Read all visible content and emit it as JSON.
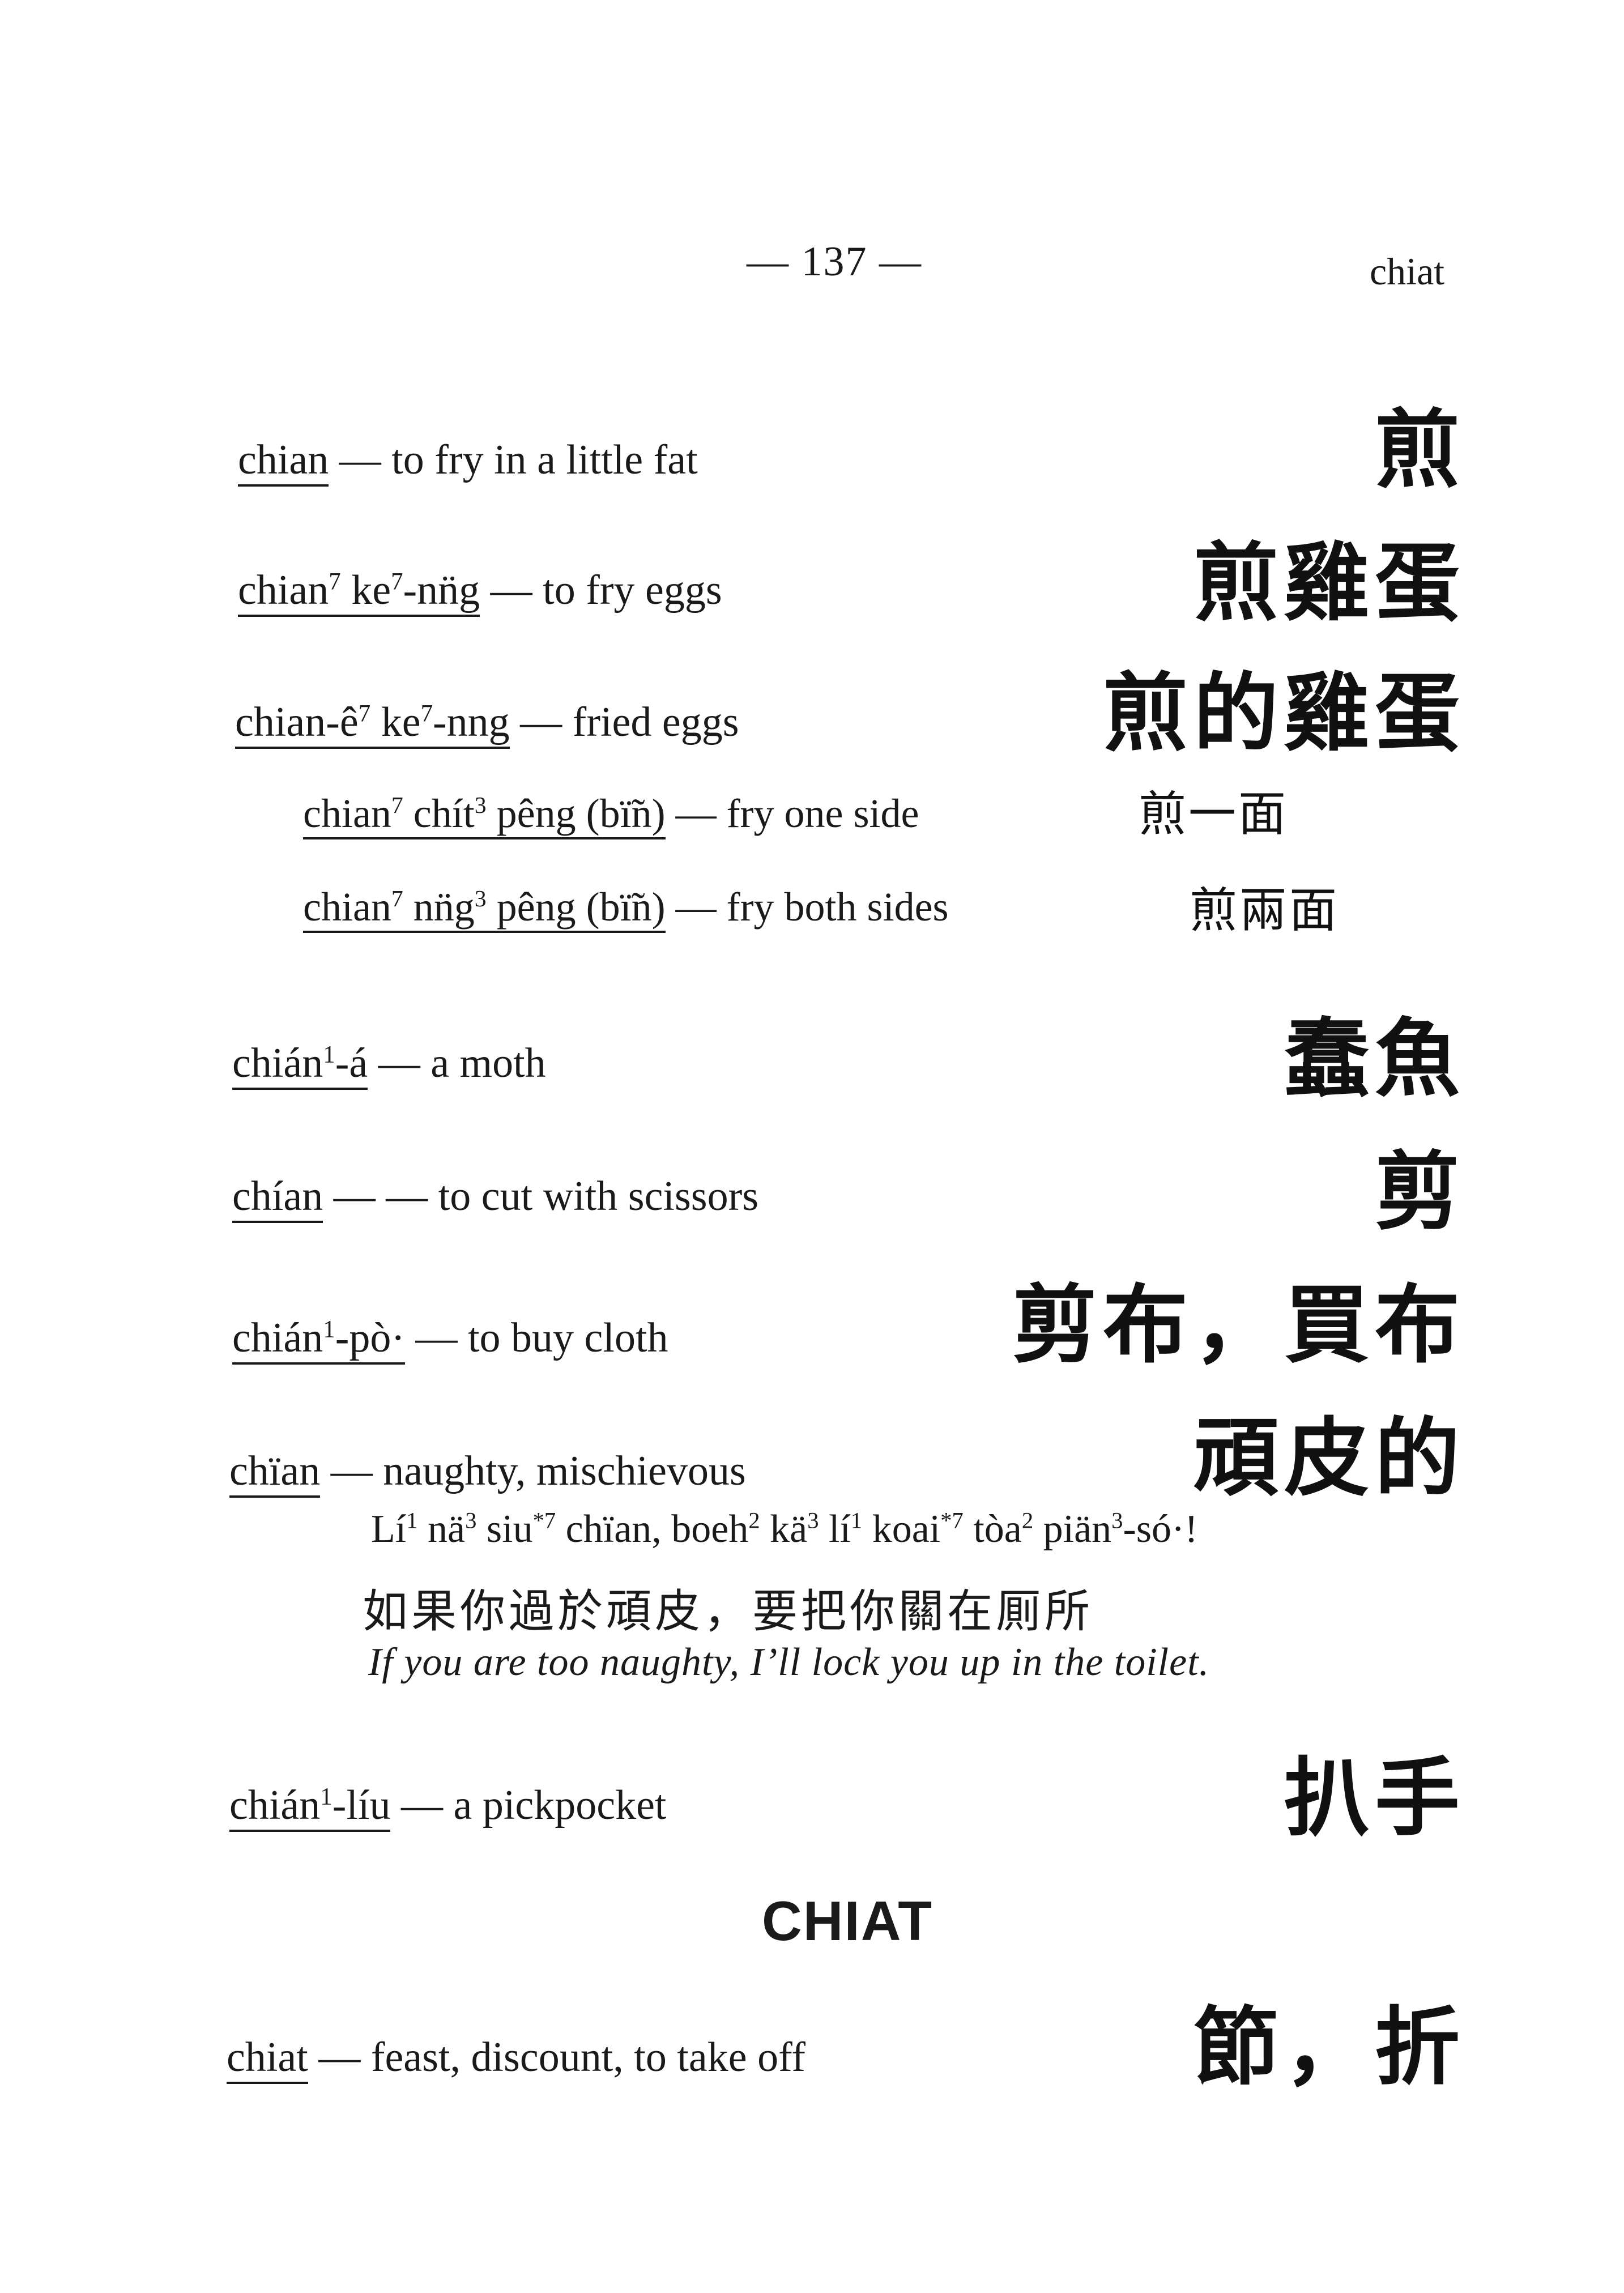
{
  "page": {
    "number_text": "— 137 —",
    "running_head": "chiat"
  },
  "entries": [
    {
      "term": "chian",
      "definition": "to fry in a little fat",
      "hanzi": "煎"
    },
    {
      "term_parts": [
        "chian",
        "7",
        " ke",
        "7",
        "-nn̈g"
      ],
      "definition": "to fry eggs",
      "hanzi": "煎雞蛋"
    },
    {
      "term_parts": [
        "chian-ê",
        "7",
        " ke",
        "7",
        "-nng"
      ],
      "definition": "fried eggs",
      "hanzi": "煎的雞蛋"
    },
    {
      "term_parts": [
        "chian",
        "7",
        " chít",
        "3",
        " pêng (bï̃n)"
      ],
      "definition": "fry one side",
      "hanzi": "煎一面"
    },
    {
      "term_parts": [
        "chian",
        "7",
        " nn̈g",
        "3",
        " pêng (bï̃n)"
      ],
      "definition": "fry both sides",
      "hanzi": "煎兩面"
    },
    {
      "term_parts": [
        "chián",
        "1",
        "-á"
      ],
      "definition": "a moth",
      "hanzi": "蠢魚"
    },
    {
      "term": "chían",
      "definition": "— to cut with scissors",
      "hanzi": "剪"
    },
    {
      "term_parts": [
        "chián",
        "1",
        "-pò·"
      ],
      "definition": "to buy cloth",
      "hanzi": "剪布，買布"
    },
    {
      "term": "chïan",
      "definition": "naughty, mischievous",
      "hanzi": "頑皮的"
    },
    {
      "term_parts": [
        "chián",
        "1",
        "-líu"
      ],
      "definition": "a pickpocket",
      "hanzi": "扒手"
    },
    {
      "term": "chiat",
      "definition": "feast, discount, to take off",
      "hanzi": "節，折"
    }
  ],
  "example": {
    "romanized_parts": [
      "Lí",
      "1",
      " nä",
      "3",
      " siu",
      "*7",
      " chïan, boeh",
      "2",
      " kä",
      "3",
      " lí",
      "1",
      " koai",
      "*7",
      " tòa",
      "2",
      " piän",
      "3",
      "-só·!"
    ],
    "chinese": "如果你過於頑皮，要把你關在厠所",
    "english": "If you are too naughty, I’ll lock you up in the toilet."
  },
  "section_heading": "CHIAT",
  "dash": "—"
}
